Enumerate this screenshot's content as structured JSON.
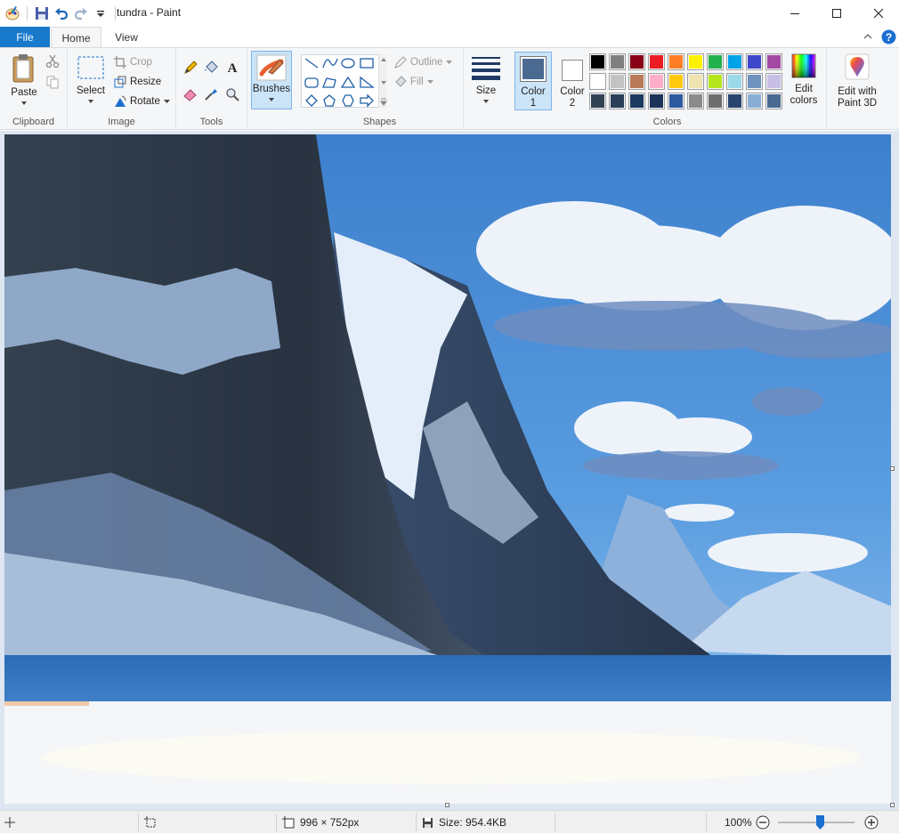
{
  "window": {
    "title": "tundra - Paint"
  },
  "tabs": {
    "file": "File",
    "home": "Home",
    "view": "View"
  },
  "clipboard": {
    "paste": "Paste",
    "label": "Clipboard"
  },
  "image": {
    "select": "Select",
    "crop": "Crop",
    "resize": "Resize",
    "rotate": "Rotate",
    "label": "Image"
  },
  "tools": {
    "label": "Tools"
  },
  "brushes": {
    "label": "Brushes"
  },
  "shapes": {
    "outline": "Outline",
    "fill": "Fill",
    "label": "Shapes"
  },
  "size": {
    "label": "Size"
  },
  "colors": {
    "color1_l1": "Color",
    "color1_l2": "1",
    "color2_l1": "Color",
    "color2_l2": "2",
    "edit_l1": "Edit",
    "edit_l2": "colors",
    "label": "Colors",
    "color1_value": "#4a6a92",
    "color2_value": "#ffffff",
    "palette_row1": [
      "#000000",
      "#7f7f7f",
      "#880015",
      "#ed1c24",
      "#ff7f27",
      "#fff200",
      "#22b14c",
      "#00a2e8",
      "#3f48cc",
      "#a349a4"
    ],
    "palette_row2": [
      "#ffffff",
      "#c3c3c3",
      "#b97a57",
      "#ffaec9",
      "#ffc90e",
      "#efe4b0",
      "#b5e61d",
      "#99d9ea",
      "#7092be",
      "#c8bfe7"
    ],
    "palette_row3": [
      "#334155",
      "#2a3f5a",
      "#1c3a5e",
      "#1a3358",
      "#2d5a9e",
      "#8a8a8a",
      "#6e6e6e",
      "#27446e",
      "#8aaed6",
      "#4a6a92"
    ]
  },
  "paint3d": {
    "l1": "Edit with",
    "l2": "Paint 3D"
  },
  "status": {
    "dimensions": "996 × 752px",
    "size": "Size: 954.4KB",
    "zoom": "100%",
    "zoom_level_fraction": 0.55
  }
}
